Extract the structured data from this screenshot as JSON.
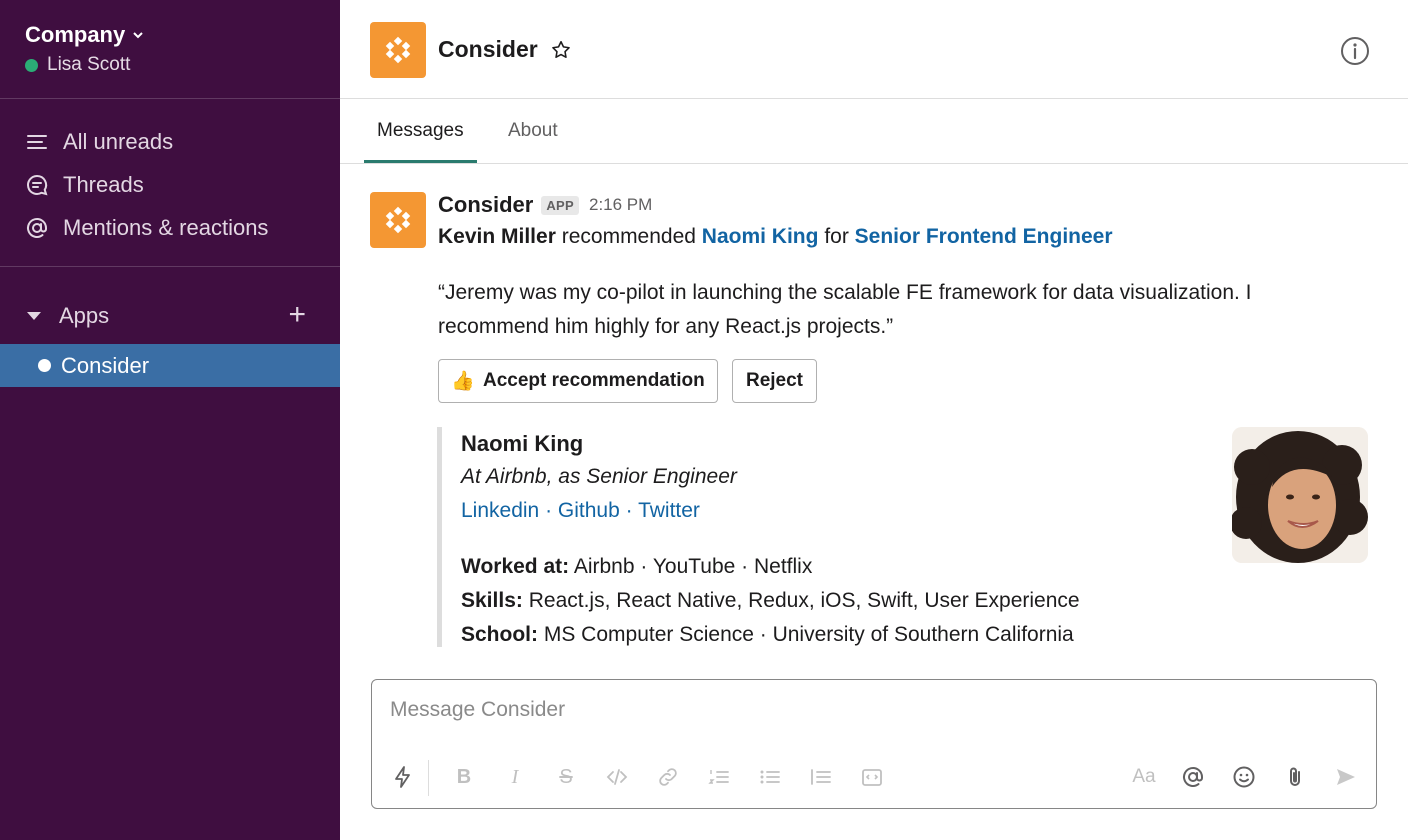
{
  "workspace": {
    "name": "Company",
    "user": "Lisa Scott"
  },
  "nav": {
    "items": [
      {
        "label": "All unreads",
        "icon": "unreads-icon"
      },
      {
        "label": "Threads",
        "icon": "threads-icon"
      },
      {
        "label": "Mentions & reactions",
        "icon": "at-icon"
      }
    ]
  },
  "apps": {
    "label": "Apps",
    "active_channel": "Consider"
  },
  "header": {
    "title": "Consider"
  },
  "tabs": [
    {
      "label": "Messages",
      "active": true
    },
    {
      "label": "About",
      "active": false
    }
  ],
  "message": {
    "sender": "Consider",
    "badge": "APP",
    "time": "2:16 PM",
    "recommender": "Kevin Miller",
    "verb": "recommended",
    "candidate": "Naomi King",
    "for_word": "for",
    "role": "Senior Frontend Engineer",
    "quote_line1": "“Jeremy was my co-pilot in launching the scalable FE framework for data visualization. I",
    "quote_line2": "recommend him highly for any React.js projects.”",
    "accept_emoji": "👍",
    "accept_label": "Accept recommendation",
    "reject_label": "Reject"
  },
  "attachment": {
    "name": "Naomi King",
    "position": "At Airbnb, as Senior Engineer",
    "links": [
      "Linkedin",
      "Github",
      "Twitter"
    ],
    "link_sep": " · ",
    "worked_label": "Worked at:",
    "worked_value": "Airbnb · YouTube · Netflix",
    "skills_label": "Skills:",
    "skills_value": "React.js, React Native, Redux, iOS, Swift, User Experience",
    "school_label": "School:",
    "school_value": "MS Computer Science · University of Southern California"
  },
  "composer": {
    "placeholder": "Message Consider",
    "format_glyph": "Aa"
  },
  "colors": {
    "sidebar": "#3f0e40",
    "active": "#3a6ea5",
    "brand": "#f49733",
    "link": "#1264a3",
    "tab_accent": "#2a7b6e",
    "presence": "#2bac76"
  }
}
